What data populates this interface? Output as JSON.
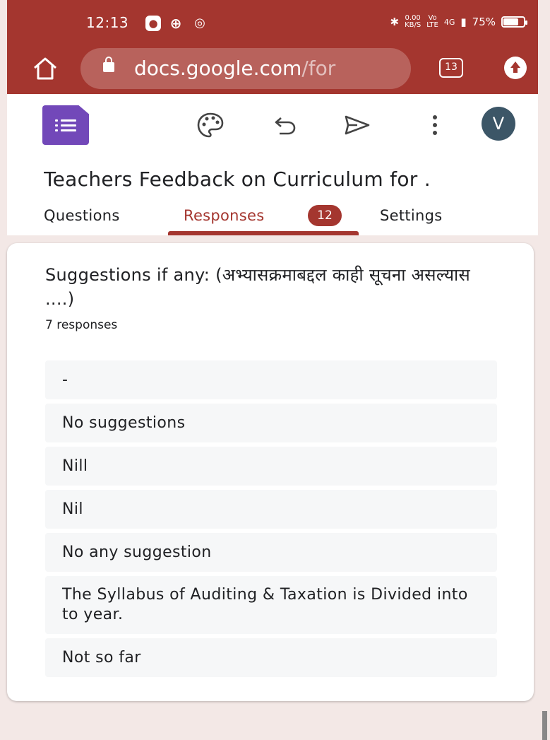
{
  "status_bar": {
    "time": "12:13",
    "net_speed_top": "0.00",
    "net_speed_bottom": "KB/S",
    "signal_top": "Vo",
    "signal_bottom": "LTE",
    "network": "4G",
    "battery": "75%",
    "battery_level": 0.75
  },
  "browser": {
    "url_main": "docs.google.com",
    "url_rest": "/for",
    "tab_count": "13"
  },
  "header": {
    "avatar_initial": "V",
    "form_title": "Teachers Feedback on Curriculum for ."
  },
  "tabs": [
    {
      "label": "Questions",
      "active": false
    },
    {
      "label": "Responses",
      "active": true,
      "badge": "12"
    },
    {
      "label": "Settings",
      "active": false
    }
  ],
  "card": {
    "question": "Suggestions if any: (अभ्यासक्रमाबद्दल काही सूचना असल्यास ....)",
    "response_count": "7 responses",
    "responses": [
      "-",
      "No suggestions",
      "Nill",
      "Nil",
      "No any suggestion",
      "The Syllabus of Auditing & Taxation is Divided into to year.",
      "Not so far"
    ]
  }
}
